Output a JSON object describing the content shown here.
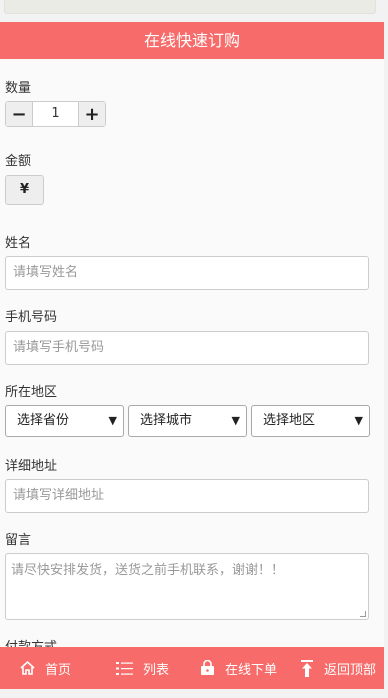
{
  "header": {
    "title": "在线快速订购"
  },
  "form": {
    "quantity": {
      "label": "数量",
      "value": "1",
      "minus": "−",
      "plus": "+"
    },
    "amount": {
      "label": "金额",
      "currency_symbol": "¥"
    },
    "name": {
      "label": "姓名",
      "placeholder": "请填写姓名"
    },
    "phone": {
      "label": "手机号码",
      "placeholder": "请填写手机号码"
    },
    "region": {
      "label": "所在地区",
      "province": "选择省份",
      "city": "选择城市",
      "district": "选择地区"
    },
    "address": {
      "label": "详细地址",
      "placeholder": "请填写详细地址"
    },
    "message": {
      "label": "留言",
      "placeholder": "请尽快安排发货，送货之前手机联系，谢谢！！"
    },
    "payment": {
      "label": "付款方式"
    }
  },
  "bottom_nav": {
    "home": "首页",
    "list": "列表",
    "order": "在线下单",
    "top": "返回顶部"
  }
}
